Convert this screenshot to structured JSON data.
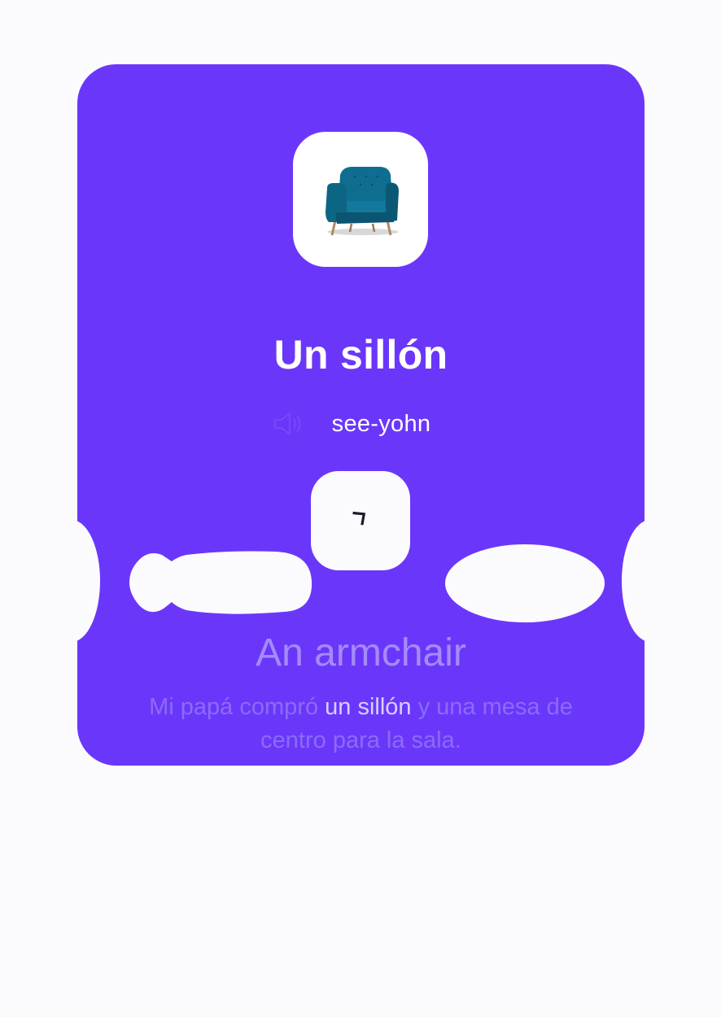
{
  "card": {
    "image_icon": "armchair-image",
    "word": "Un sillón",
    "pronunciation": "see-yohn",
    "speaker_icon": "speaker-icon",
    "flip_icon": "rotate-icon",
    "translation": "An armchair",
    "example": {
      "before": "Mi papá compró ",
      "highlight": "un sillón",
      "after": " y una mesa de centro para la sala."
    }
  },
  "colors": {
    "card_bg": "#6a37fa",
    "page_bg": "#fbfbfd",
    "armchair": "#0f6e8f"
  }
}
